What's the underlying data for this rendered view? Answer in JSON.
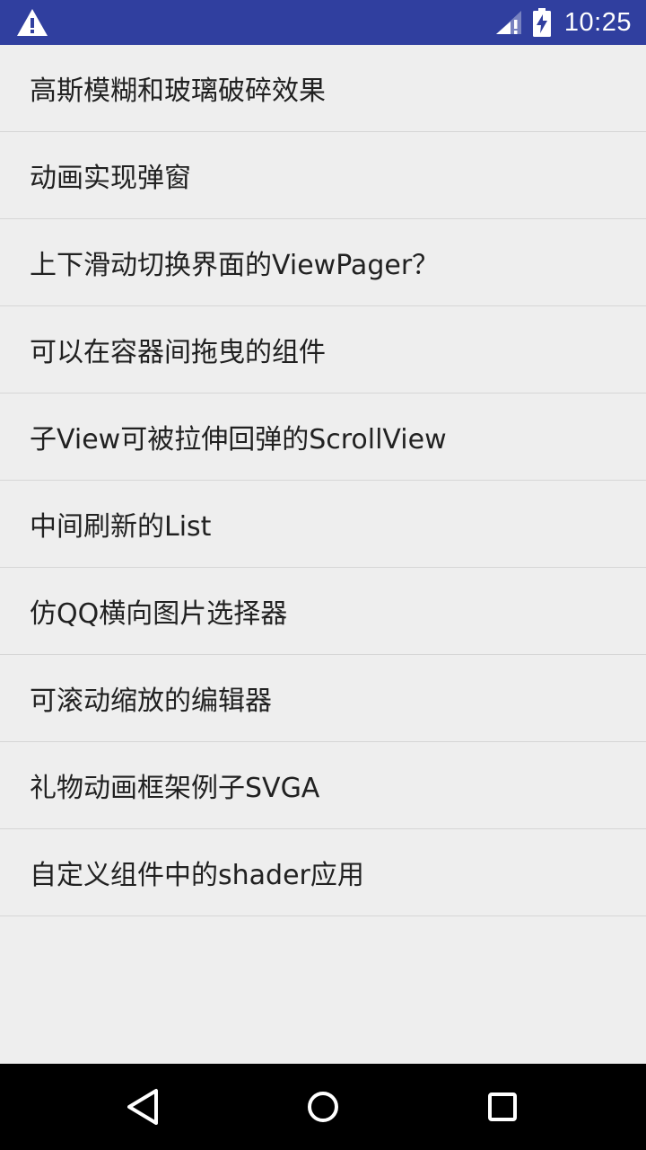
{
  "status_bar": {
    "time": "10:25",
    "icons": [
      "warning-icon",
      "signal-icon",
      "battery-charging-icon"
    ]
  },
  "list": {
    "items": [
      {
        "label": "高斯模糊和玻璃破碎效果"
      },
      {
        "label": "动画实现弹窗"
      },
      {
        "label": "上下滑动切换界面的ViewPager？"
      },
      {
        "label": "可以在容器间拖曳的组件"
      },
      {
        "label": "子View可被拉伸回弹的ScrollView"
      },
      {
        "label": "中间刷新的List"
      },
      {
        "label": "仿QQ横向图片选择器"
      },
      {
        "label": "可滚动缩放的编辑器"
      },
      {
        "label": "礼物动画框架例子SVGA"
      },
      {
        "label": "自定义组件中的shader应用"
      }
    ]
  },
  "nav_bar": {
    "icons": [
      "back-icon",
      "home-icon",
      "recents-icon"
    ]
  },
  "colors": {
    "status_bar": "#303f9f",
    "background": "#eeeeee",
    "divider": "#d6d6d6",
    "text": "#212121",
    "nav_bar": "#000000"
  }
}
